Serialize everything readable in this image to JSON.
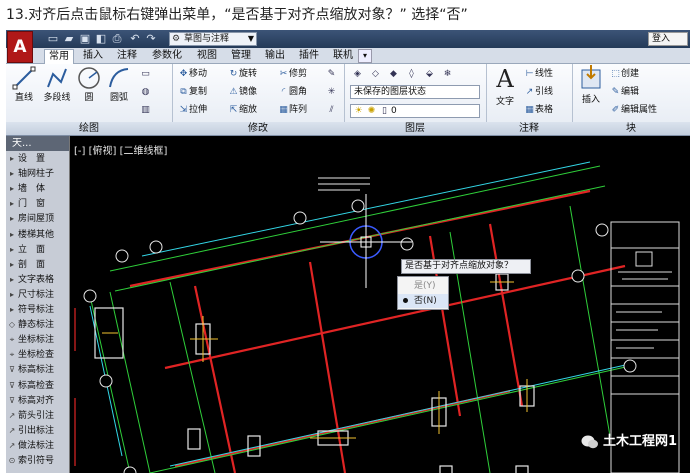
{
  "caption": "13.对齐后点击鼠标右键弹出菜单，“是否基于对齐点缩放对象？” 选择“否”",
  "app": {
    "logo_letter": "A",
    "workspace": "草图与注释",
    "login": "登入"
  },
  "tabs": [
    "常用",
    "插入",
    "注释",
    "参数化",
    "视图",
    "管理",
    "输出",
    "插件",
    "联机"
  ],
  "ribbon": {
    "draw": {
      "line": "直线",
      "polyline": "多段线",
      "circle": "圆",
      "arc": "圆弧"
    },
    "modify": {
      "move": "移动",
      "rotate": "旋转",
      "trim": "修剪",
      "copy": "复制",
      "mirror": "镜像",
      "fillet": "圆角",
      "stretch": "拉伸",
      "scale": "缩放",
      "array": "阵列"
    },
    "layers": {
      "state": "未保存的图层状态",
      "current": "0"
    },
    "annotation": {
      "text": "文字",
      "linear": "线性",
      "leader": "引线",
      "table": "表格"
    },
    "block": {
      "insert": "插入",
      "create": "创建",
      "edit": "编辑",
      "edit_attr": "编辑属性"
    }
  },
  "groups": [
    "绘图",
    "修改",
    "图层",
    "注释",
    "块"
  ],
  "palette": {
    "header": "天...",
    "items": [
      "设　置",
      "轴网柱子",
      "墙　体",
      "门　窗",
      "房间屋顶",
      "楼梯其他",
      "立　面",
      "剖　面",
      "文字表格",
      "尺寸标注",
      "符号标注",
      "静态标注",
      "坐标标注",
      "坐标检查",
      "标高标注",
      "标高检查",
      "标高对齐",
      "箭头引注",
      "引出标注",
      "做法标注",
      "索引符号"
    ]
  },
  "viewport": {
    "label": "[-] [俯视] [二维线框]"
  },
  "prompt": {
    "question": "是否基于对齐点缩放对象？"
  },
  "context_menu": {
    "yes": "是(Y)",
    "no": "否(N)",
    "selected": "no"
  },
  "watermark": "土木工程网1",
  "colors": {
    "accent": "#2c5d9e",
    "canvas": "#000000",
    "grid_red": "#e02424",
    "grid_green": "#2fcf3a",
    "dim_cyan": "#33d6e6"
  }
}
